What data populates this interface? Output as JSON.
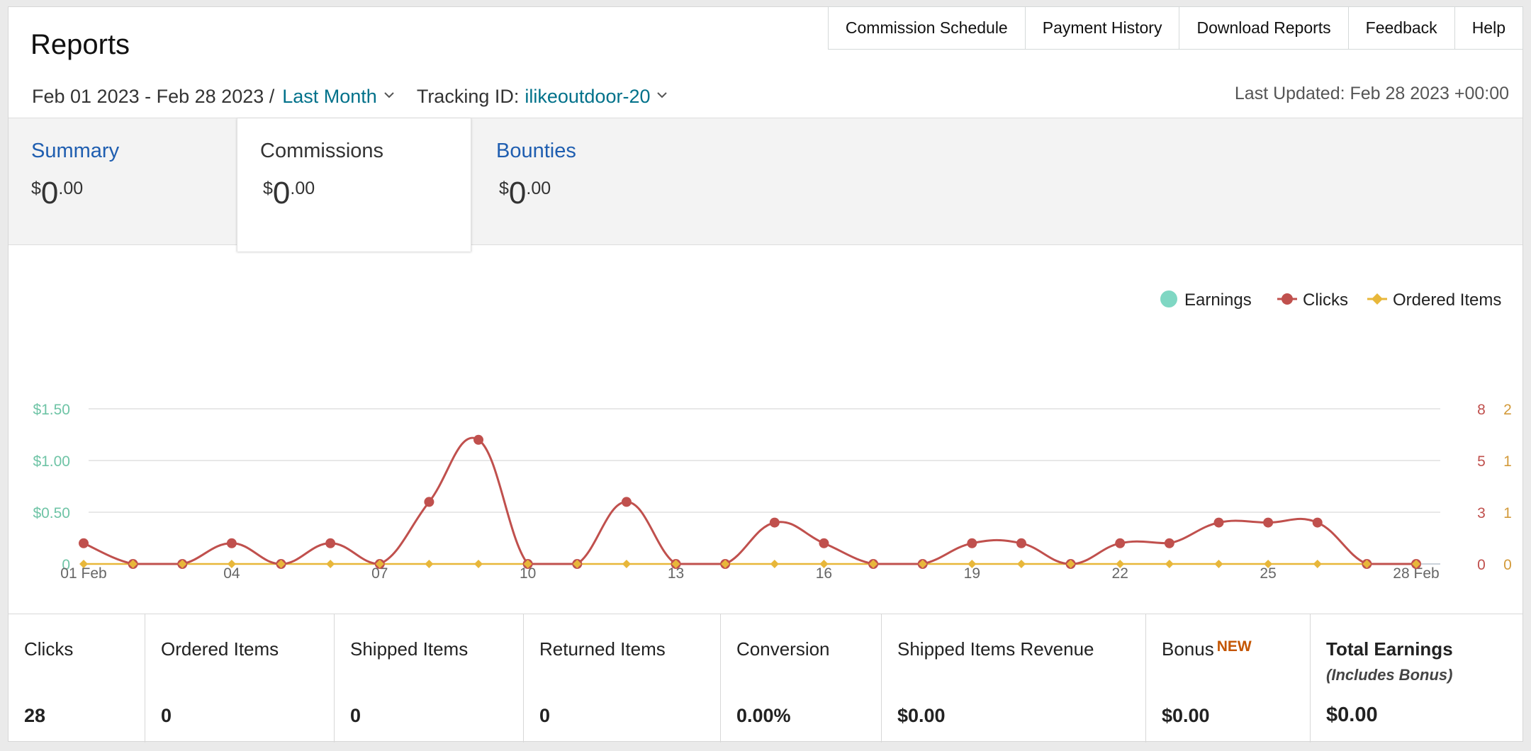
{
  "header": {
    "title": "Reports",
    "nav": [
      "Commission Schedule",
      "Payment History",
      "Download Reports",
      "Feedback",
      "Help"
    ],
    "date_range": "Feb 01 2023 - Feb 28 2023 /",
    "range_preset": "Last Month",
    "tracking_label": "Tracking ID:",
    "tracking_id": "ilikeoutdoor-20",
    "last_updated": "Last Updated: Feb 28 2023 +00:00"
  },
  "metric_tabs": [
    {
      "label": "Summary",
      "currency": "$",
      "whole": "0",
      "cents": ".00"
    },
    {
      "label": "Commissions",
      "currency": "$",
      "whole": "0",
      "cents": ".00"
    },
    {
      "label": "Bounties",
      "currency": "$",
      "whole": "0",
      "cents": ".00"
    }
  ],
  "colors": {
    "earnings": "#7fd7c3",
    "clicks": "#c0504d",
    "ordered_items": "#e8b73a",
    "earnings_axis": "#6fc4a6",
    "clicks_axis": "#c0504d",
    "items_axis": "#d39a3a",
    "link": "#00718a",
    "tab_link": "#1f5eb0",
    "new_badge": "#c45500"
  },
  "chart_data": {
    "type": "line",
    "x": [
      "01 Feb",
      "02",
      "03",
      "04",
      "05",
      "06",
      "07",
      "08",
      "09",
      "10",
      "11",
      "12",
      "13",
      "14",
      "15",
      "16",
      "17",
      "18",
      "19",
      "20",
      "21",
      "22",
      "23",
      "24",
      "25",
      "26",
      "27",
      "28 Feb"
    ],
    "x_ticks": [
      "01 Feb",
      "04",
      "07",
      "10",
      "13",
      "16",
      "19",
      "22",
      "25",
      "28 Feb"
    ],
    "series": [
      {
        "name": "Earnings",
        "axis": "left",
        "marker": "circle",
        "values": [
          0,
          0,
          0,
          0,
          0,
          0,
          0,
          0,
          0,
          0,
          0,
          0,
          0,
          0,
          0,
          0,
          0,
          0,
          0,
          0,
          0,
          0,
          0,
          0,
          0,
          0,
          0,
          0
        ]
      },
      {
        "name": "Clicks",
        "axis": "right1",
        "marker": "circle",
        "values": [
          1,
          0,
          0,
          1,
          0,
          1,
          0,
          3,
          6,
          0,
          0,
          3,
          0,
          0,
          2,
          1,
          0,
          0,
          1,
          1,
          0,
          1,
          1,
          2,
          2,
          2,
          0,
          0
        ]
      },
      {
        "name": "Ordered Items",
        "axis": "right2",
        "marker": "diamond",
        "values": [
          0,
          0,
          0,
          0,
          0,
          0,
          0,
          0,
          0,
          0,
          0,
          0,
          0,
          0,
          0,
          0,
          0,
          0,
          0,
          0,
          0,
          0,
          0,
          0,
          0,
          0,
          0,
          0
        ]
      }
    ],
    "left_axis": {
      "ticks": [
        "0",
        "$0.50",
        "$1.00",
        "$1.50"
      ],
      "ylim": [
        0,
        1.5
      ]
    },
    "right_axis_1": {
      "ticks": [
        "0",
        "3",
        "5",
        "8"
      ],
      "ylim": [
        0,
        7.5
      ]
    },
    "right_axis_2": {
      "ticks": [
        "0",
        "1",
        "1",
        "2"
      ],
      "ylim": [
        0,
        1.5
      ]
    },
    "legend": [
      "Earnings",
      "Clicks",
      "Ordered Items"
    ],
    "legend_position": "top-right",
    "grid": true
  },
  "stats": [
    {
      "label": "Clicks",
      "value": "28"
    },
    {
      "label": "Ordered Items",
      "value": "0"
    },
    {
      "label": "Shipped Items",
      "value": "0"
    },
    {
      "label": "Returned Items",
      "value": "0"
    },
    {
      "label": "Conversion",
      "value": "0.00%"
    },
    {
      "label": "Shipped Items Revenue",
      "value": "$0.00"
    },
    {
      "label": "Bonus",
      "badge": "NEW",
      "value": "$0.00"
    },
    {
      "label": "Total Earnings",
      "sublabel": "(Includes Bonus)",
      "value": "$0.00"
    }
  ]
}
